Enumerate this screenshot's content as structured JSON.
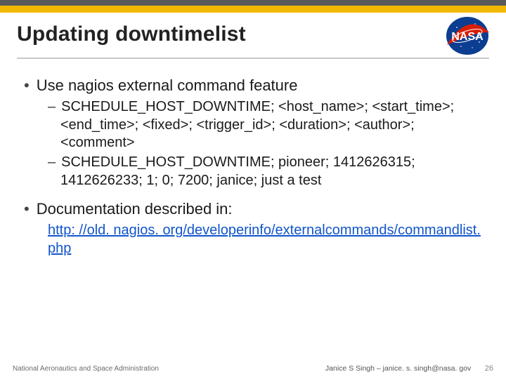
{
  "title": "Updating downtimelist",
  "bullets": [
    {
      "text": "Use nagios external command feature",
      "sub": [
        "SCHEDULE_HOST_DOWNTIME; <host_name>; <start_time>; <end_time>; <fixed>; <trigger_id>; <duration>; <author>; <comment>",
        "SCHEDULE_HOST_DOWNTIME; pioneer; 1412626315; 1412626233; 1; 0; 7200; janice; just a test"
      ]
    },
    {
      "text": "Documentation described in:",
      "link": "http: //old. nagios. org/developerinfo/externalcommands/commandlist. php"
    }
  ],
  "footer": {
    "org": "National Aeronautics and Space Administration",
    "author": "Janice S Singh – janice. s. singh@nasa. gov",
    "page": "26"
  }
}
